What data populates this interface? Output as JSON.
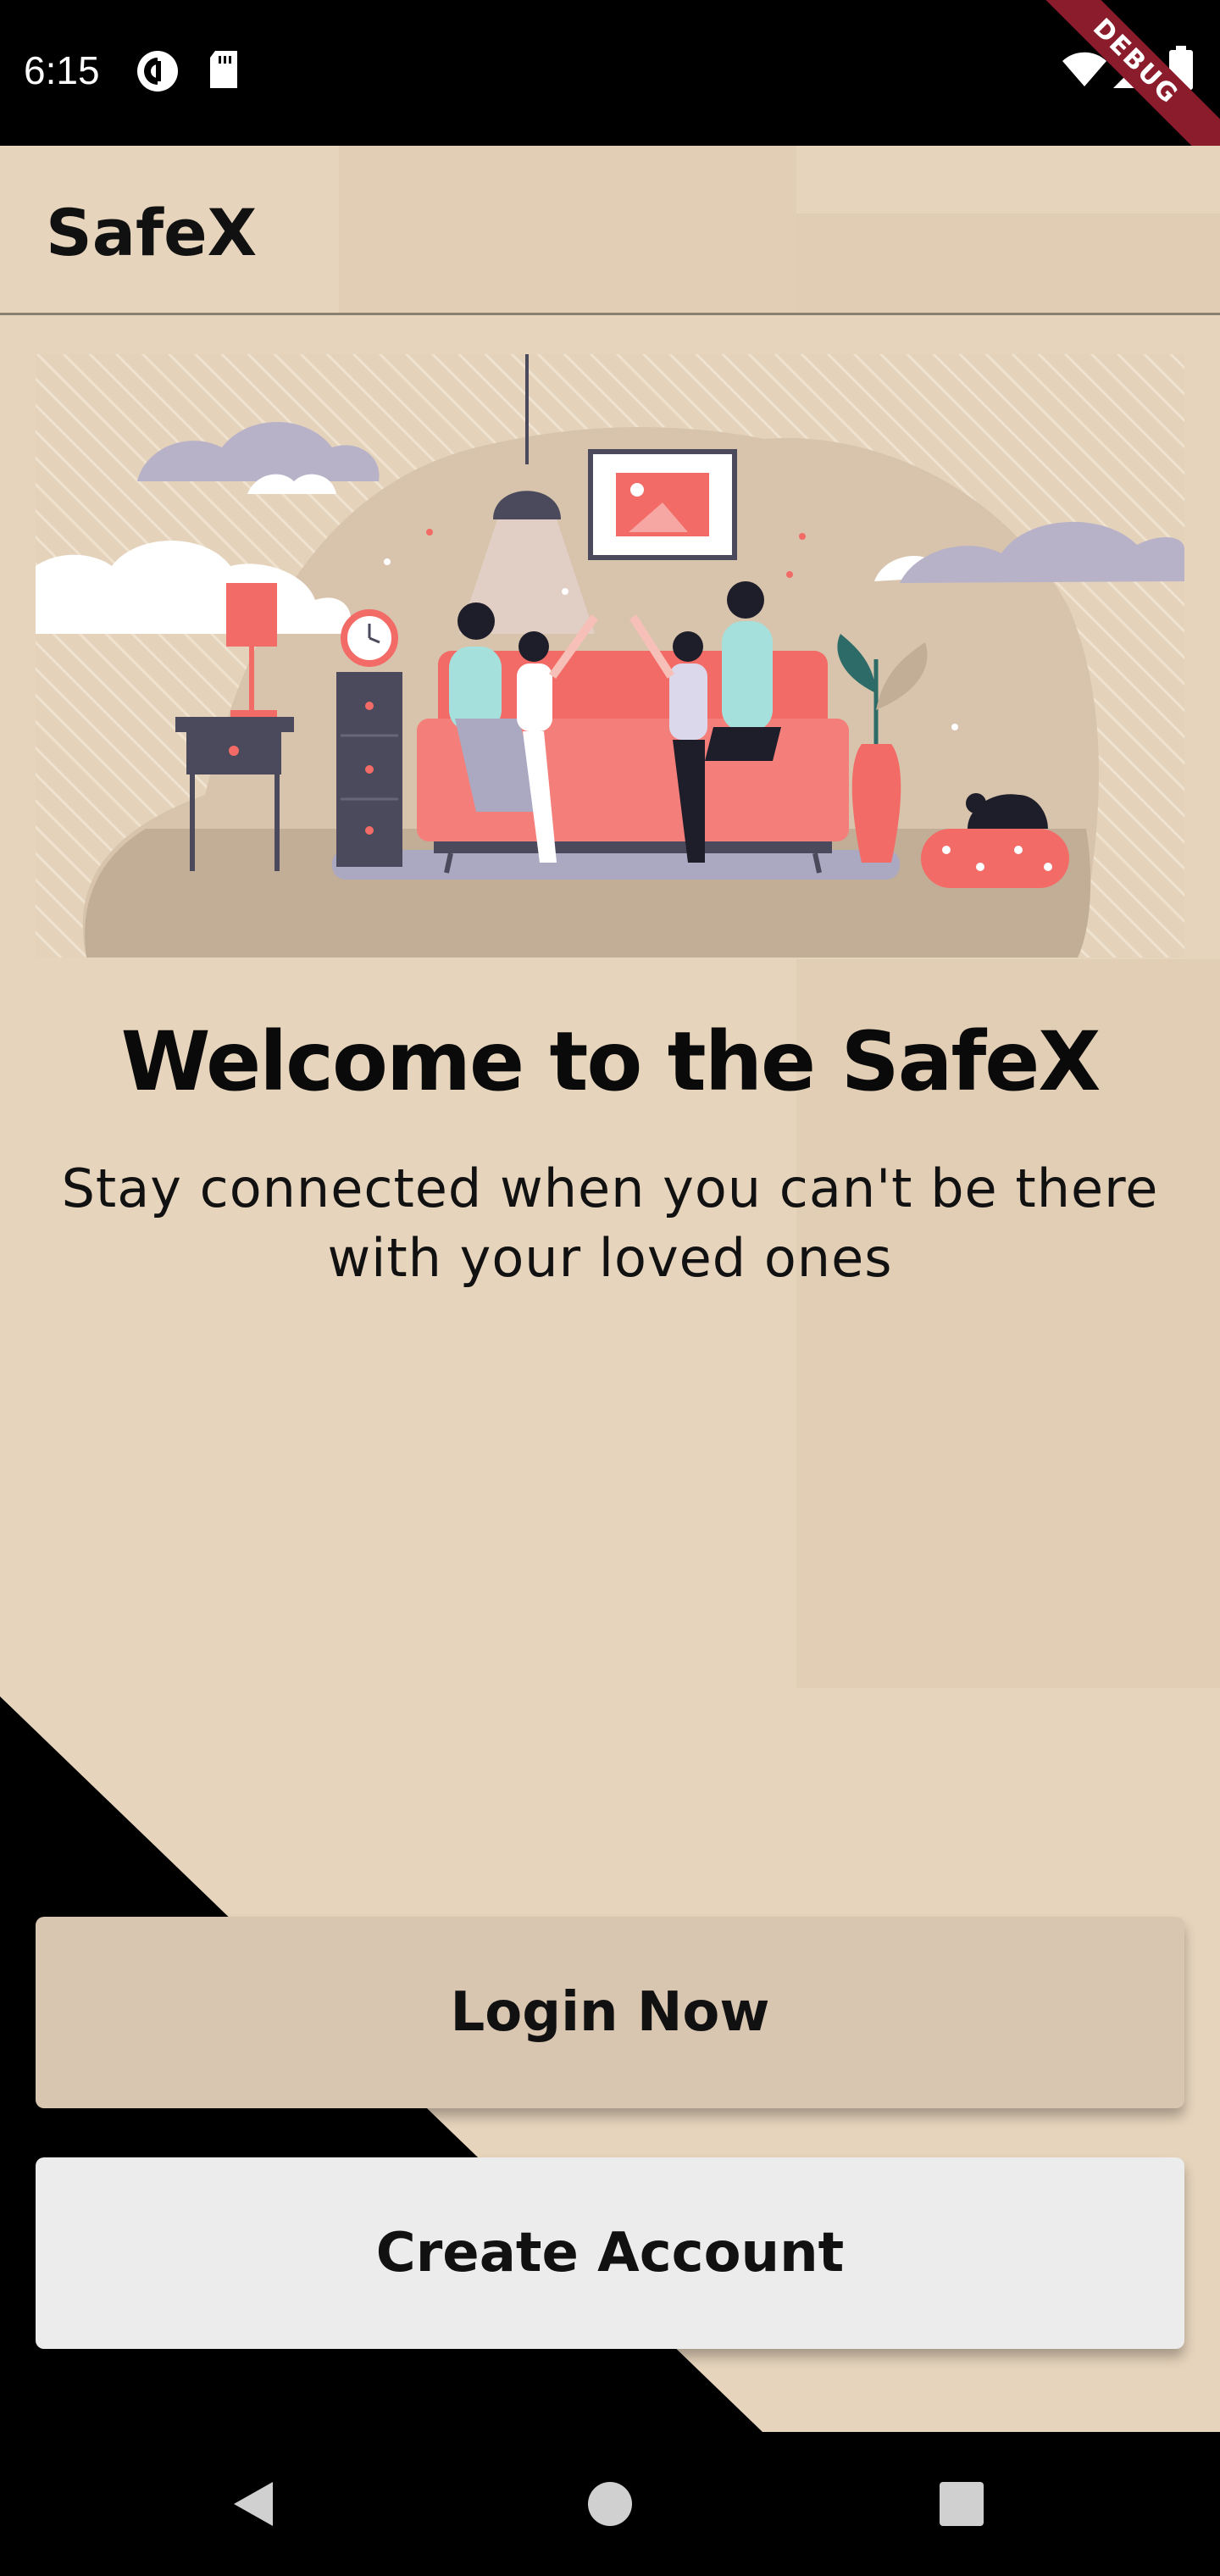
{
  "status_bar": {
    "time": "6:15",
    "icons": [
      "pocket-casts-icon",
      "sd-card-icon",
      "wifi-icon",
      "signal-icon",
      "battery-icon"
    ],
    "debug_label": "DEBUG"
  },
  "app_bar": {
    "title": "SafeX"
  },
  "hero": {
    "illustration": "family-on-sofa-illustration",
    "title": "Welcome to the SafeX",
    "subtitle_line1": "Stay connected when you can't be there",
    "subtitle_line2": "with your loved ones"
  },
  "actions": {
    "login_label": "Login Now",
    "create_label": "Create Account"
  },
  "nav_bar": {
    "icons": [
      "back-icon",
      "home-icon",
      "recents-icon"
    ]
  },
  "colors": {
    "background": "#e6d4bc",
    "login_button": "#d9c6b0",
    "create_button": "#ececec",
    "sofa": "#f26b66",
    "accent_dark": "#4a4a5c"
  }
}
